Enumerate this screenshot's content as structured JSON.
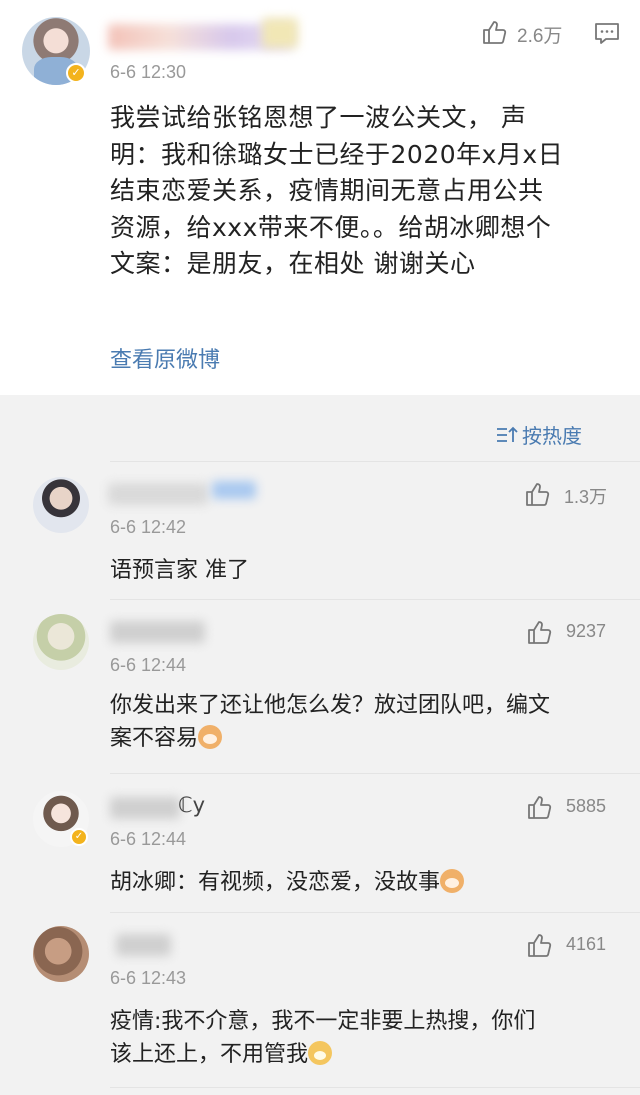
{
  "post": {
    "date": "6-6 12:30",
    "likes": "2.6万",
    "text_lines": [
      "我尝试给张铭恩想了一波公关文， 声",
      "明：我和徐璐女士已经于2020年x月x日",
      "结束恋爱关系，疫情期间无意占用公共",
      "资源，给xxx带来不便。。给胡冰卿想个",
      "文案：是朋友，在相处  谢谢关心"
    ],
    "view_original": "查看原微博"
  },
  "sort": {
    "label": "按热度"
  },
  "comments": [
    {
      "date": "6-6 12:42",
      "likes": "1.3万",
      "lines": [
        "语预言家 准了"
      ]
    },
    {
      "date": "6-6 12:44",
      "likes": "9237",
      "lines": [
        "你发出来了还让他怎么发？放过团队吧，编文",
        "案不容易"
      ]
    },
    {
      "name_visible": "ℂy",
      "date": "6-6 12:44",
      "likes": "5885",
      "lines": [
        "胡冰卿：有视频，没恋爱，没故事"
      ]
    },
    {
      "date": "6-6 12:43",
      "likes": "4161",
      "lines": [
        "疫情:我不介意，我不一定非要上热搜，你们",
        "该上还上，不用管我"
      ]
    }
  ],
  "colors": {
    "link": "#4a7bb1",
    "meta": "#999999",
    "badge": "#f3b31d"
  },
  "icons": {
    "like": "thumb-up-icon",
    "comment": "comment-icon",
    "sort": "sort-icon",
    "emoji_cat": "cat-emoji-icon",
    "emoji_dog": "dog-emoji-icon"
  }
}
